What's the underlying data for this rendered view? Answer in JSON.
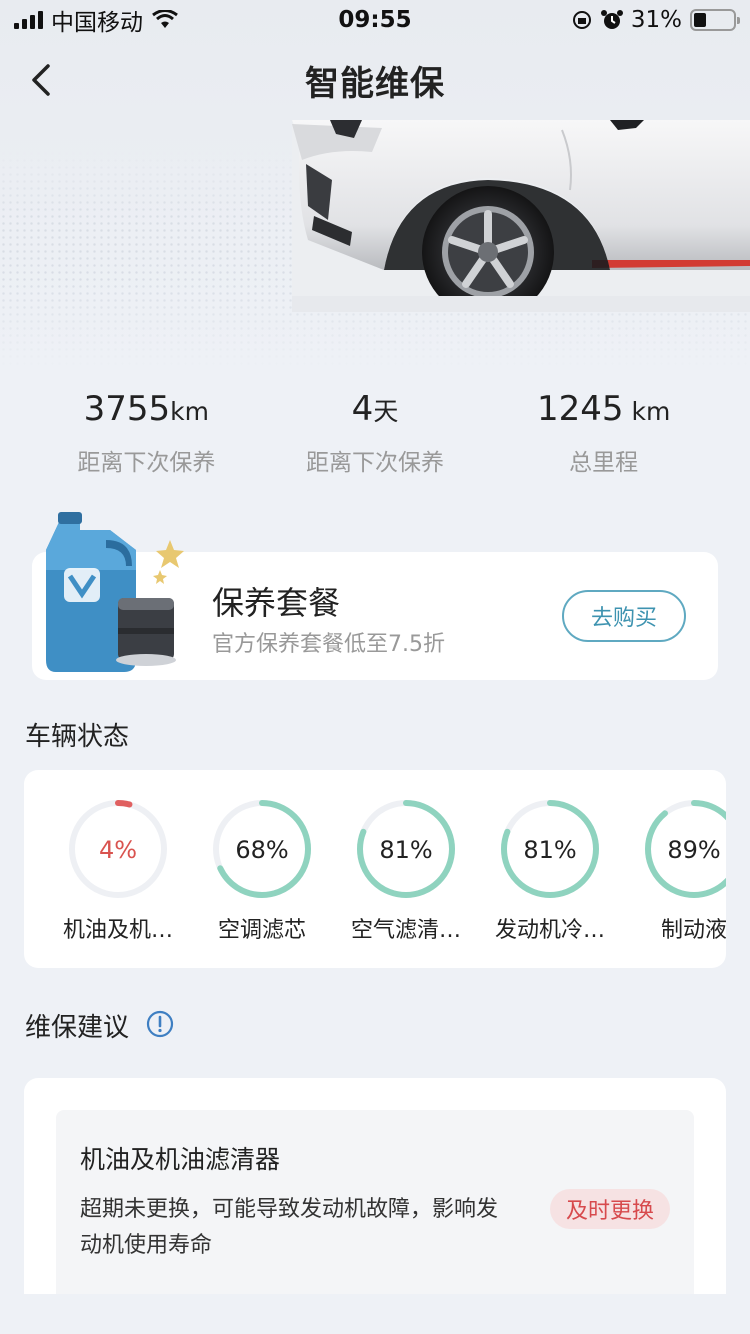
{
  "status_bar": {
    "carrier": "中国移动",
    "time": "09:55",
    "battery": "31%",
    "battery_level": 0.31
  },
  "nav": {
    "title": "智能维保",
    "back_icon": "chevron-left-icon"
  },
  "stats": [
    {
      "value": "3755",
      "unit": "km",
      "label": "距离下次保养"
    },
    {
      "value": "4",
      "unit": "天",
      "label": "距离下次保养"
    },
    {
      "value": "1245",
      "unit": " km",
      "label": "总里程"
    }
  ],
  "package": {
    "title": "保养套餐",
    "subtitle": "官方保养套餐低至7.5折",
    "button": "去购买"
  },
  "vehicle_status": {
    "title": "车辆状态",
    "items": [
      {
        "percent": "4%",
        "value": 4,
        "label": "机油及机…",
        "color": "#e06060",
        "text_color": "#d9534f"
      },
      {
        "percent": "68%",
        "value": 68,
        "label": "空调滤芯",
        "color": "#8fd3bf",
        "text_color": "#222222"
      },
      {
        "percent": "81%",
        "value": 81,
        "label": "空气滤清…",
        "color": "#8fd3bf",
        "text_color": "#222222"
      },
      {
        "percent": "81%",
        "value": 81,
        "label": "发动机冷…",
        "color": "#8fd3bf",
        "text_color": "#222222"
      },
      {
        "percent": "89%",
        "value": 89,
        "label": "制动液",
        "color": "#8fd3bf",
        "text_color": "#222222"
      }
    ]
  },
  "suggestion": {
    "title": "维保建议",
    "info_icon": "info-icon",
    "item_title": "机油及机油滤清器",
    "item_desc": "超期未更换，可能导致发动机故障，影响发动机使用寿命",
    "badge": "及时更换"
  },
  "colors": {
    "accent": "#3e93b0",
    "warning": "#d74a4d",
    "gauge_good": "#8fd3bf",
    "gauge_bad": "#e06060"
  }
}
